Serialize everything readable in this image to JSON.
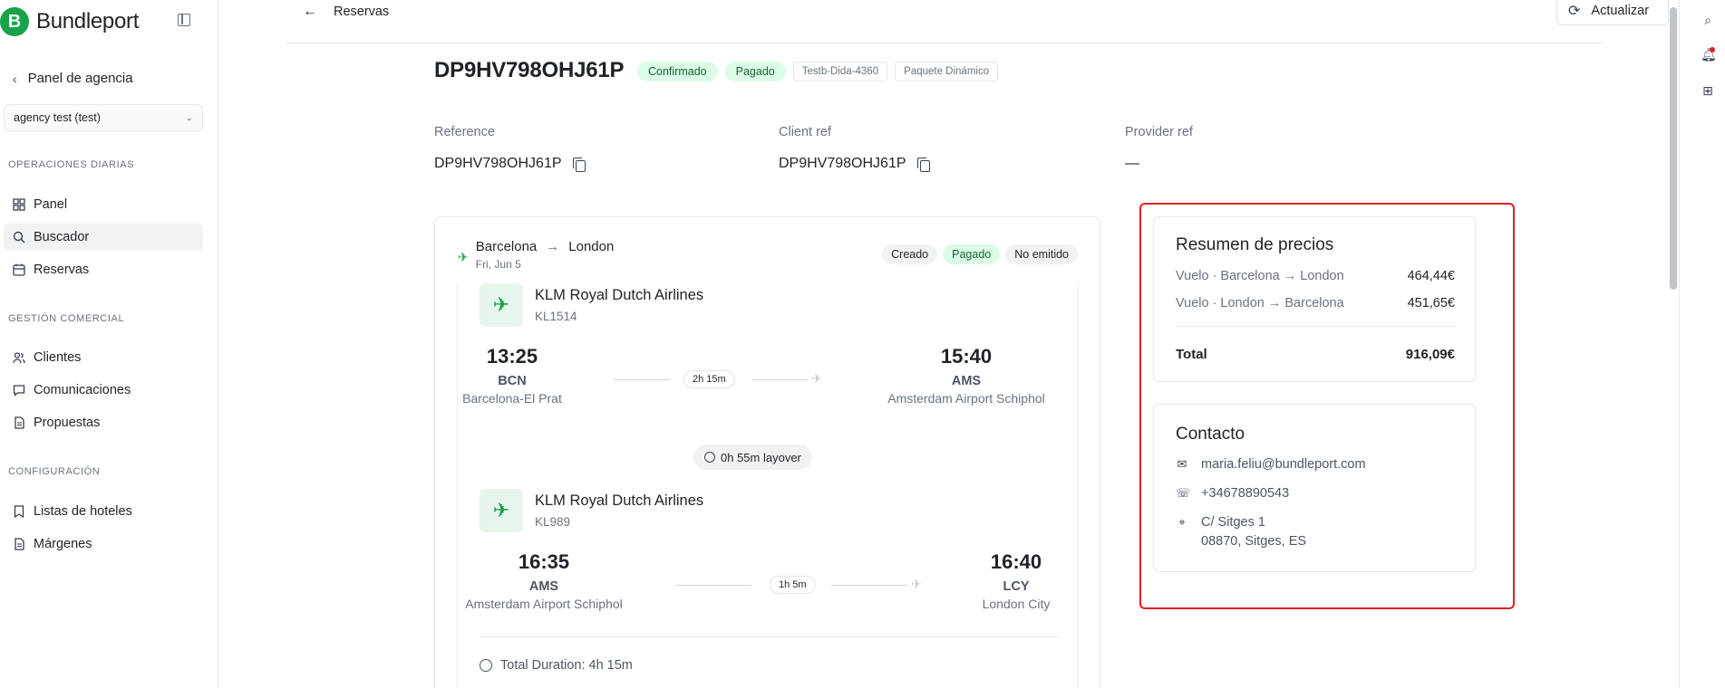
{
  "brand": {
    "logo_letter": "B",
    "name": "Bundleport"
  },
  "sidebar": {
    "back_label": "Panel de agencia",
    "agency_select": "agency test (test)",
    "sections": [
      {
        "title": "OPERACIONES DIARIAS",
        "items": [
          "Panel",
          "Buscador",
          "Reservas"
        ]
      },
      {
        "title": "GESTIÓN COMERCIAL",
        "items": [
          "Clientes",
          "Comunicaciones",
          "Propuestas"
        ]
      },
      {
        "title": "CONFIGURACIÓN",
        "items": [
          "Listas de hoteles",
          "Márgenes"
        ]
      }
    ],
    "active_item": "Buscador"
  },
  "header": {
    "back_label": "Reservas",
    "refresh_label": "Actualizar"
  },
  "booking": {
    "id": "DP9HV798OHJ61P",
    "badges": [
      "Confirmado",
      "Pagado"
    ],
    "tags": [
      "Testb-Dida-4360",
      "Paquete Dinámico"
    ]
  },
  "refs": [
    {
      "label": "Reference",
      "value": "DP9HV798OHJ61P",
      "copy": true
    },
    {
      "label": "Client ref",
      "value": "DP9HV798OHJ61P",
      "copy": true
    },
    {
      "label": "Provider ref",
      "value": "—",
      "copy": false
    }
  ],
  "flight": {
    "origin": "Barcelona",
    "destination": "London",
    "date": "Fri, Jun 5",
    "statuses": [
      "Creado",
      "Pagado",
      "No emitido"
    ],
    "segments": [
      {
        "airline": "KLM Royal Dutch Airlines",
        "flight_no": "KL1514",
        "dep_time": "13:25",
        "dep_iata": "BCN",
        "dep_airport": "Barcelona-El Prat",
        "arr_time": "15:40",
        "arr_iata": "AMS",
        "arr_airport": "Amsterdam Airport Schiphol",
        "duration": "2h 15m"
      },
      {
        "airline": "KLM Royal Dutch Airlines",
        "flight_no": "KL989",
        "dep_time": "16:35",
        "dep_iata": "AMS",
        "dep_airport": "Amsterdam Airport Schiphol",
        "arr_time": "16:40",
        "arr_iata": "LCY",
        "arr_airport": "London City",
        "duration": "1h 5m"
      }
    ],
    "layover": "0h 55m layover",
    "total_duration": "Total Duration: 4h 15m"
  },
  "prices": {
    "title": "Resumen de precios",
    "rows": [
      {
        "label": "Vuelo · Barcelona → London",
        "amount": "464,44€"
      },
      {
        "label": "Vuelo · London → Barcelona",
        "amount": "451,65€"
      }
    ],
    "total_label": "Total",
    "total_amount": "916,09€"
  },
  "contact": {
    "title": "Contacto",
    "email": "maria.feliu@bundleport.com",
    "phone": "+34678890543",
    "address_line1": "C/ Sitges 1",
    "address_line2": "08870, Sitges, ES"
  },
  "colors": {
    "accent": "#16a34a",
    "highlight": "#e11d24",
    "badge_green_bg": "#dcfce7"
  }
}
